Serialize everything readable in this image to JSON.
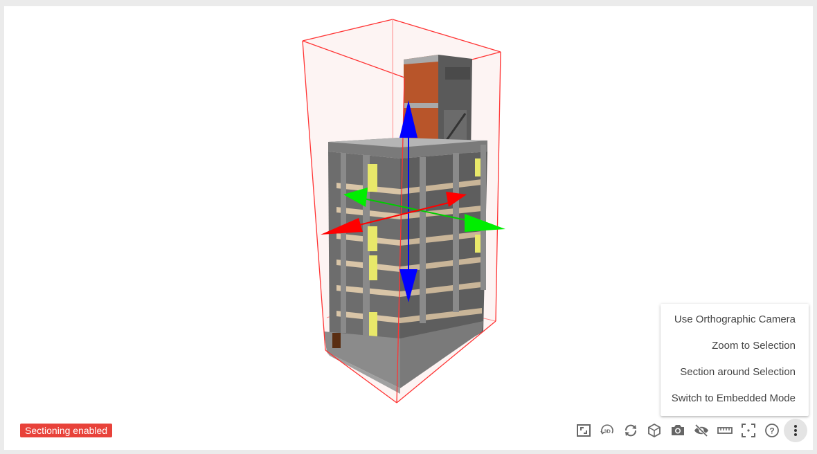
{
  "status_badge": {
    "label": "Sectioning enabled",
    "color": "#e8423a"
  },
  "context_menu": {
    "items": [
      {
        "label": "Use Orthographic Camera"
      },
      {
        "label": "Zoom to Selection"
      },
      {
        "label": "Section around Selection"
      },
      {
        "label": "Switch to Embedded Mode"
      }
    ]
  },
  "toolbar": {
    "tools": [
      {
        "icon": "fit-view-icon"
      },
      {
        "icon": "3d-view-icon",
        "label": "3D"
      },
      {
        "icon": "orbit-icon"
      },
      {
        "icon": "cube-icon"
      },
      {
        "icon": "camera-icon"
      },
      {
        "icon": "hide-icon"
      },
      {
        "icon": "measure-ruler-icon"
      },
      {
        "icon": "section-box-icon"
      },
      {
        "icon": "help-icon",
        "label": "?"
      },
      {
        "icon": "more-menu-icon",
        "active": true
      }
    ]
  },
  "gizmo_colors": {
    "x_axis": "#ff0000",
    "y_axis": "#00ff00",
    "z_axis": "#0000ff",
    "section_box": "#ff3333"
  }
}
